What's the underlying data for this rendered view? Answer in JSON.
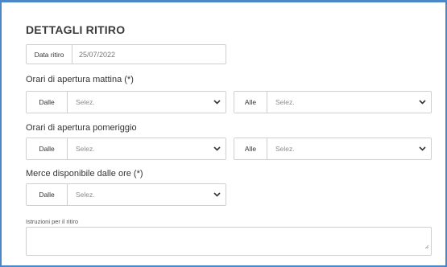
{
  "section_title": "DETTAGLI RITIRO",
  "pickup_date": {
    "label": "Data ritiro",
    "value": "25/07/2022"
  },
  "morning_hours": {
    "label": "Orari di apertura mattina (*)",
    "from_label": "Dalle",
    "from_value": "Selez.",
    "to_label": "Alle",
    "to_value": "Selez."
  },
  "afternoon_hours": {
    "label": "Orari di apertura pomeriggio",
    "from_label": "Dalle",
    "from_value": "Selez.",
    "to_label": "Alle",
    "to_value": "Selez."
  },
  "goods_available": {
    "label": "Merce disponibile dalle ore (*)",
    "from_label": "Dalle",
    "from_value": "Selez."
  },
  "instructions": {
    "label": "Istruzioni per il ritiro",
    "value": ""
  },
  "colors": {
    "frame_border": "#4a86c8",
    "field_border": "#cfcfcf"
  },
  "icons": {
    "dropdown": "chevron-down-icon",
    "resize": "resize-handle-icon"
  }
}
